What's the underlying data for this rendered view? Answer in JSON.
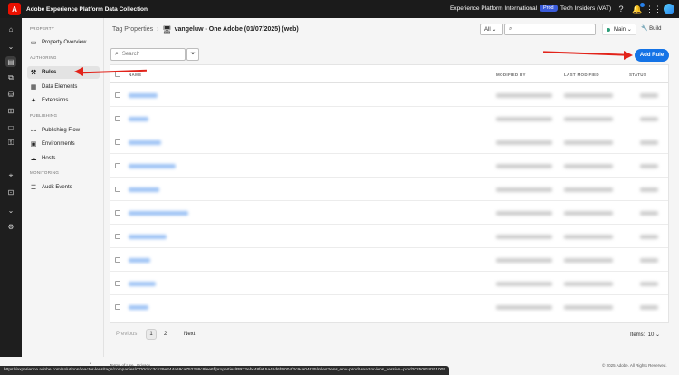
{
  "topbar": {
    "logo_letter": "A",
    "app_title": "Adobe Experience Platform Data Collection",
    "org": "Experience Platform International",
    "env_badge": "Prod",
    "sandbox": "Tech Insiders (VAT)",
    "icons": [
      "help-icon",
      "bell-icon",
      "apps-grid-icon",
      "avatar"
    ]
  },
  "sidebar": {
    "sections": [
      {
        "label": "PROPERTY",
        "items": [
          {
            "label": "Property Overview",
            "icon": "folder-icon"
          }
        ]
      },
      {
        "label": "AUTHORING",
        "items": [
          {
            "label": "Rules",
            "icon": "rules-icon",
            "active": true
          },
          {
            "label": "Data Elements",
            "icon": "data-elements-icon"
          },
          {
            "label": "Extensions",
            "icon": "extensions-icon"
          }
        ]
      },
      {
        "label": "PUBLISHING",
        "items": [
          {
            "label": "Publishing Flow",
            "icon": "publishing-flow-icon"
          },
          {
            "label": "Environments",
            "icon": "environments-icon"
          },
          {
            "label": "Hosts",
            "icon": "hosts-icon"
          }
        ]
      },
      {
        "label": "MONITORING",
        "items": [
          {
            "label": "Audit Events",
            "icon": "audit-events-icon"
          }
        ]
      }
    ]
  },
  "header": {
    "breadcrumb_root": "Tag Properties",
    "breadcrumb_sep": "›",
    "property_name": "vangeluw - One Adobe (01/07/2025) (web)",
    "filter_select": "All",
    "library_name": "Main",
    "build_label": "Build"
  },
  "toolbar": {
    "search_placeholder": "Search",
    "add_rule_label": "Add Rule"
  },
  "table": {
    "columns": {
      "name": "NAME",
      "modified_by": "MODIFIED BY",
      "last_modified": "LAST MODIFIED",
      "status": "STATUS"
    }
  },
  "pagination": {
    "prev_label": "Previous",
    "pages": [
      "1",
      "2"
    ],
    "next_label": "Next",
    "items_label": "Items:",
    "items_value": "10"
  },
  "footer": {
    "terms": "Terms of Use",
    "privacy": "Privacy",
    "copyright": "© 2025 Adobe. All Rights Reserved.",
    "status_url": "https://experience.adobe.com/solutions/reactor-lens/tags/companies/CO0cfcc3cb29e244a69ca752286c9fee6f/properties/PR72ebc48fe15a46d6b6004f2c9ca04635/rules?lens_env=prod&reactor-lens_version=prod20250618201005"
  },
  "colors": {
    "accent": "#1473e6",
    "annotation_arrow": "#e2231a"
  }
}
